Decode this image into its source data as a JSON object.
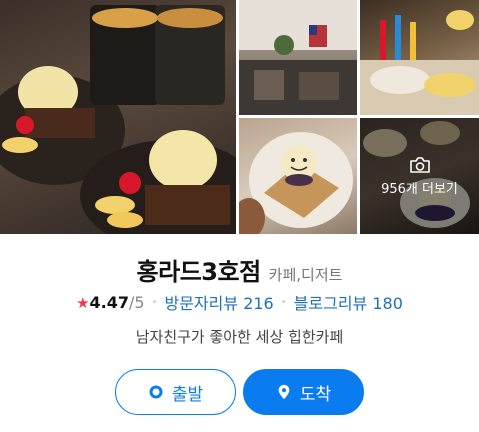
{
  "gallery": {
    "more_label": "956개 더보기",
    "icons": {
      "more": "camera-icon"
    }
  },
  "place": {
    "name": "홍라드3호점",
    "category": "카페,디저트",
    "rating": "4.47",
    "rating_max": "/5",
    "visitor_reviews_label": "방문자리뷰 216",
    "blog_reviews_label": "블로그리뷰 180",
    "description": "남자친구가 좋아한 세상 힙한카페"
  },
  "actions": {
    "start_label": "출발",
    "arrive_label": "도착"
  },
  "colors": {
    "accent": "#0a7cf0",
    "star": "#f0394c",
    "review_link": "#1f6fbf"
  }
}
